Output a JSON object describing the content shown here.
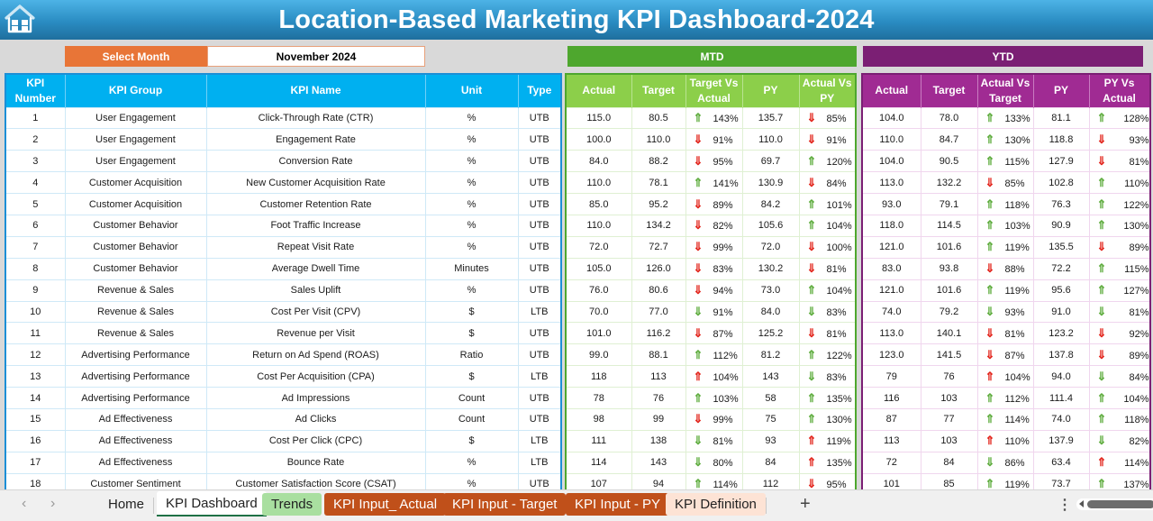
{
  "header": {
    "title": "Location-Based Marketing KPI Dashboard-2024",
    "home_icon": "home-icon"
  },
  "month_selector": {
    "label": "Select Month",
    "value": "November 2024"
  },
  "sections": {
    "mtd": "MTD",
    "ytd": "YTD"
  },
  "columns": {
    "info": [
      "KPI Number",
      "KPI Group",
      "KPI Name",
      "Unit",
      "Type"
    ],
    "mtd": [
      "Actual",
      "Target",
      "Target Vs Actual",
      "PY",
      "Actual Vs PY"
    ],
    "ytd": [
      "Actual",
      "Target",
      "Actual Vs Target",
      "PY",
      "PY Vs Actual"
    ]
  },
  "colors": {
    "title_bar": "#2a8cc2",
    "select_month": "#e87537",
    "info_header": "#00b0f0",
    "mtd_band": "#4ea72e",
    "mtd_header": "#8ccf4a",
    "ytd_band": "#7b1f74",
    "ytd_header": "#a02b93",
    "arrow_good": "#5cab3b",
    "arrow_bad": "#e2231a"
  },
  "rows": [
    {
      "num": "1",
      "group": "User Engagement",
      "name": "Click-Through Rate (CTR)",
      "unit": "%",
      "type": "UTB",
      "mtd": {
        "actual": "115.0",
        "target": "80.5",
        "tva": "143%",
        "tva_arrow": "up",
        "tva_color": "green",
        "py": "135.7",
        "avp": "85%",
        "avp_arrow": "down",
        "avp_color": "red"
      },
      "ytd": {
        "actual": "104.0",
        "target": "78.0",
        "avt": "133%",
        "avt_arrow": "up",
        "avt_color": "green",
        "py": "81.1",
        "pva": "128%",
        "pva_arrow": "up",
        "pva_color": "green"
      }
    },
    {
      "num": "2",
      "group": "User Engagement",
      "name": "Engagement Rate",
      "unit": "%",
      "type": "UTB",
      "mtd": {
        "actual": "100.0",
        "target": "110.0",
        "tva": "91%",
        "tva_arrow": "down",
        "tva_color": "red",
        "py": "110.0",
        "avp": "91%",
        "avp_arrow": "down",
        "avp_color": "red"
      },
      "ytd": {
        "actual": "110.0",
        "target": "84.7",
        "avt": "130%",
        "avt_arrow": "up",
        "avt_color": "green",
        "py": "118.8",
        "pva": "93%",
        "pva_arrow": "down",
        "pva_color": "red"
      }
    },
    {
      "num": "3",
      "group": "User Engagement",
      "name": "Conversion Rate",
      "unit": "%",
      "type": "UTB",
      "mtd": {
        "actual": "84.0",
        "target": "88.2",
        "tva": "95%",
        "tva_arrow": "down",
        "tva_color": "red",
        "py": "69.7",
        "avp": "120%",
        "avp_arrow": "up",
        "avp_color": "green"
      },
      "ytd": {
        "actual": "104.0",
        "target": "90.5",
        "avt": "115%",
        "avt_arrow": "up",
        "avt_color": "green",
        "py": "127.9",
        "pva": "81%",
        "pva_arrow": "down",
        "pva_color": "red"
      }
    },
    {
      "num": "4",
      "group": "Customer Acquisition",
      "name": "New Customer Acquisition Rate",
      "unit": "%",
      "type": "UTB",
      "mtd": {
        "actual": "110.0",
        "target": "78.1",
        "tva": "141%",
        "tva_arrow": "up",
        "tva_color": "green",
        "py": "130.9",
        "avp": "84%",
        "avp_arrow": "down",
        "avp_color": "red"
      },
      "ytd": {
        "actual": "113.0",
        "target": "132.2",
        "avt": "85%",
        "avt_arrow": "down",
        "avt_color": "red",
        "py": "102.8",
        "pva": "110%",
        "pva_arrow": "up",
        "pva_color": "green"
      }
    },
    {
      "num": "5",
      "group": "Customer Acquisition",
      "name": "Customer Retention Rate",
      "unit": "%",
      "type": "UTB",
      "mtd": {
        "actual": "85.0",
        "target": "95.2",
        "tva": "89%",
        "tva_arrow": "down",
        "tva_color": "red",
        "py": "84.2",
        "avp": "101%",
        "avp_arrow": "up",
        "avp_color": "green"
      },
      "ytd": {
        "actual": "93.0",
        "target": "79.1",
        "avt": "118%",
        "avt_arrow": "up",
        "avt_color": "green",
        "py": "76.3",
        "pva": "122%",
        "pva_arrow": "up",
        "pva_color": "green"
      }
    },
    {
      "num": "6",
      "group": "Customer Behavior",
      "name": "Foot Traffic Increase",
      "unit": "%",
      "type": "UTB",
      "mtd": {
        "actual": "110.0",
        "target": "134.2",
        "tva": "82%",
        "tva_arrow": "down",
        "tva_color": "red",
        "py": "105.6",
        "avp": "104%",
        "avp_arrow": "up",
        "avp_color": "green"
      },
      "ytd": {
        "actual": "118.0",
        "target": "114.5",
        "avt": "103%",
        "avt_arrow": "up",
        "avt_color": "green",
        "py": "90.9",
        "pva": "130%",
        "pva_arrow": "up",
        "pva_color": "green"
      }
    },
    {
      "num": "7",
      "group": "Customer Behavior",
      "name": "Repeat Visit Rate",
      "unit": "%",
      "type": "UTB",
      "mtd": {
        "actual": "72.0",
        "target": "72.7",
        "tva": "99%",
        "tva_arrow": "down",
        "tva_color": "red",
        "py": "72.0",
        "avp": "100%",
        "avp_arrow": "down",
        "avp_color": "red"
      },
      "ytd": {
        "actual": "121.0",
        "target": "101.6",
        "avt": "119%",
        "avt_arrow": "up",
        "avt_color": "green",
        "py": "135.5",
        "pva": "89%",
        "pva_arrow": "down",
        "pva_color": "red"
      }
    },
    {
      "num": "8",
      "group": "Customer Behavior",
      "name": "Average Dwell Time",
      "unit": "Minutes",
      "type": "UTB",
      "mtd": {
        "actual": "105.0",
        "target": "126.0",
        "tva": "83%",
        "tva_arrow": "down",
        "tva_color": "red",
        "py": "130.2",
        "avp": "81%",
        "avp_arrow": "down",
        "avp_color": "red"
      },
      "ytd": {
        "actual": "83.0",
        "target": "93.8",
        "avt": "88%",
        "avt_arrow": "down",
        "avt_color": "red",
        "py": "72.2",
        "pva": "115%",
        "pva_arrow": "up",
        "pva_color": "green"
      }
    },
    {
      "num": "9",
      "group": "Revenue & Sales",
      "name": "Sales Uplift",
      "unit": "%",
      "type": "UTB",
      "mtd": {
        "actual": "76.0",
        "target": "80.6",
        "tva": "94%",
        "tva_arrow": "down",
        "tva_color": "red",
        "py": "73.0",
        "avp": "104%",
        "avp_arrow": "up",
        "avp_color": "green"
      },
      "ytd": {
        "actual": "121.0",
        "target": "101.6",
        "avt": "119%",
        "avt_arrow": "up",
        "avt_color": "green",
        "py": "95.6",
        "pva": "127%",
        "pva_arrow": "up",
        "pva_color": "green"
      }
    },
    {
      "num": "10",
      "group": "Revenue & Sales",
      "name": "Cost Per Visit (CPV)",
      "unit": "$",
      "type": "LTB",
      "mtd": {
        "actual": "70.0",
        "target": "77.0",
        "tva": "91%",
        "tva_arrow": "down",
        "tva_color": "green",
        "py": "84.0",
        "avp": "83%",
        "avp_arrow": "down",
        "avp_color": "green"
      },
      "ytd": {
        "actual": "74.0",
        "target": "79.2",
        "avt": "93%",
        "avt_arrow": "down",
        "avt_color": "green",
        "py": "91.0",
        "pva": "81%",
        "pva_arrow": "down",
        "pva_color": "green"
      }
    },
    {
      "num": "11",
      "group": "Revenue & Sales",
      "name": "Revenue per Visit",
      "unit": "$",
      "type": "UTB",
      "mtd": {
        "actual": "101.0",
        "target": "116.2",
        "tva": "87%",
        "tva_arrow": "down",
        "tva_color": "red",
        "py": "125.2",
        "avp": "81%",
        "avp_arrow": "down",
        "avp_color": "red"
      },
      "ytd": {
        "actual": "113.0",
        "target": "140.1",
        "avt": "81%",
        "avt_arrow": "down",
        "avt_color": "red",
        "py": "123.2",
        "pva": "92%",
        "pva_arrow": "down",
        "pva_color": "red"
      }
    },
    {
      "num": "12",
      "group": "Advertising Performance",
      "name": "Return on Ad Spend (ROAS)",
      "unit": "Ratio",
      "type": "UTB",
      "mtd": {
        "actual": "99.0",
        "target": "88.1",
        "tva": "112%",
        "tva_arrow": "up",
        "tva_color": "green",
        "py": "81.2",
        "avp": "122%",
        "avp_arrow": "up",
        "avp_color": "green"
      },
      "ytd": {
        "actual": "123.0",
        "target": "141.5",
        "avt": "87%",
        "avt_arrow": "down",
        "avt_color": "red",
        "py": "137.8",
        "pva": "89%",
        "pva_arrow": "down",
        "pva_color": "red"
      }
    },
    {
      "num": "13",
      "group": "Advertising Performance",
      "name": "Cost Per Acquisition (CPA)",
      "unit": "$",
      "type": "LTB",
      "mtd": {
        "actual": "118",
        "target": "113",
        "tva": "104%",
        "tva_arrow": "up",
        "tva_color": "red",
        "py": "143",
        "avp": "83%",
        "avp_arrow": "down",
        "avp_color": "green"
      },
      "ytd": {
        "actual": "79",
        "target": "76",
        "avt": "104%",
        "avt_arrow": "up",
        "avt_color": "red",
        "py": "94.0",
        "pva": "84%",
        "pva_arrow": "down",
        "pva_color": "green"
      }
    },
    {
      "num": "14",
      "group": "Advertising Performance",
      "name": "Ad Impressions",
      "unit": "Count",
      "type": "UTB",
      "mtd": {
        "actual": "78",
        "target": "76",
        "tva": "103%",
        "tva_arrow": "up",
        "tva_color": "green",
        "py": "58",
        "avp": "135%",
        "avp_arrow": "up",
        "avp_color": "green"
      },
      "ytd": {
        "actual": "116",
        "target": "103",
        "avt": "112%",
        "avt_arrow": "up",
        "avt_color": "green",
        "py": "111.4",
        "pva": "104%",
        "pva_arrow": "up",
        "pva_color": "green"
      }
    },
    {
      "num": "15",
      "group": "Ad Effectiveness",
      "name": "Ad Clicks",
      "unit": "Count",
      "type": "UTB",
      "mtd": {
        "actual": "98",
        "target": "99",
        "tva": "99%",
        "tva_arrow": "down",
        "tva_color": "red",
        "py": "75",
        "avp": "130%",
        "avp_arrow": "up",
        "avp_color": "green"
      },
      "ytd": {
        "actual": "87",
        "target": "77",
        "avt": "114%",
        "avt_arrow": "up",
        "avt_color": "green",
        "py": "74.0",
        "pva": "118%",
        "pva_arrow": "up",
        "pva_color": "green"
      }
    },
    {
      "num": "16",
      "group": "Ad Effectiveness",
      "name": "Cost Per Click (CPC)",
      "unit": "$",
      "type": "LTB",
      "mtd": {
        "actual": "111",
        "target": "138",
        "tva": "81%",
        "tva_arrow": "down",
        "tva_color": "green",
        "py": "93",
        "avp": "119%",
        "avp_arrow": "up",
        "avp_color": "red"
      },
      "ytd": {
        "actual": "113",
        "target": "103",
        "avt": "110%",
        "avt_arrow": "up",
        "avt_color": "red",
        "py": "137.9",
        "pva": "82%",
        "pva_arrow": "down",
        "pva_color": "green"
      }
    },
    {
      "num": "17",
      "group": "Ad Effectiveness",
      "name": "Bounce Rate",
      "unit": "%",
      "type": "LTB",
      "mtd": {
        "actual": "114",
        "target": "143",
        "tva": "80%",
        "tva_arrow": "down",
        "tva_color": "green",
        "py": "84",
        "avp": "135%",
        "avp_arrow": "up",
        "avp_color": "red"
      },
      "ytd": {
        "actual": "72",
        "target": "84",
        "avt": "86%",
        "avt_arrow": "down",
        "avt_color": "green",
        "py": "63.4",
        "pva": "114%",
        "pva_arrow": "up",
        "pva_color": "red"
      }
    },
    {
      "num": "18",
      "group": "Customer Sentiment",
      "name": "Customer Satisfaction Score (CSAT)",
      "unit": "%",
      "type": "UTB",
      "mtd": {
        "actual": "107",
        "target": "94",
        "tva": "114%",
        "tva_arrow": "up",
        "tva_color": "green",
        "py": "112",
        "avp": "95%",
        "avp_arrow": "down",
        "avp_color": "red"
      },
      "ytd": {
        "actual": "101",
        "target": "85",
        "avt": "119%",
        "avt_arrow": "up",
        "avt_color": "green",
        "py": "73.7",
        "pva": "137%",
        "pva_arrow": "up",
        "pva_color": "green"
      }
    }
  ],
  "sheet_tabs": [
    {
      "label": "Home",
      "style": "plain"
    },
    {
      "label": "KPI Dashboard",
      "style": "active"
    },
    {
      "label": "Trends",
      "style": "green"
    },
    {
      "label": "KPI Input_ Actual",
      "style": "orange"
    },
    {
      "label": "KPI Input - Target",
      "style": "orange"
    },
    {
      "label": "KPI Input - PY",
      "style": "orange"
    },
    {
      "label": "KPI Definition",
      "style": "peach"
    }
  ],
  "tabbar_icons": {
    "prev": "‹",
    "next": "›",
    "add": "+",
    "more": "⋮"
  },
  "arrows": {
    "up": "⇑",
    "down": "⇓"
  }
}
